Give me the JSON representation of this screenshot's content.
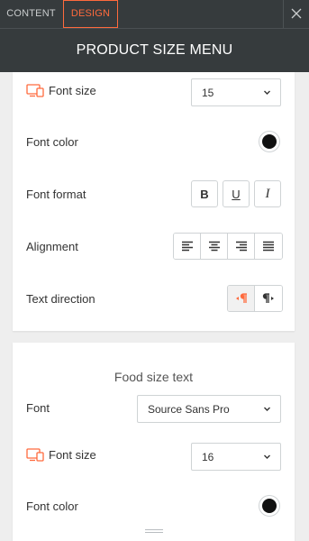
{
  "tabs": [
    {
      "label": "CONTENT",
      "active": false
    },
    {
      "label": "DESIGN",
      "active": true
    }
  ],
  "header": {
    "title": "PRODUCT SIZE MENU"
  },
  "accent_color": "#ff6a3d",
  "panel1": {
    "font_size": {
      "label": "Font size",
      "value": "15",
      "icon": "desktop-icon"
    },
    "font_color": {
      "label": "Font color",
      "color": "#111111"
    },
    "font_format": {
      "label": "Font format",
      "buttons": [
        "B",
        "U",
        "I"
      ]
    },
    "alignment": {
      "label": "Alignment",
      "options": [
        "align-left",
        "align-center",
        "align-right",
        "align-justify"
      ]
    },
    "text_direction": {
      "label": "Text direction",
      "options": [
        "ltr",
        "rtl"
      ],
      "active": "ltr"
    }
  },
  "panel2": {
    "section_title": "Food size text",
    "font": {
      "label": "Font",
      "value": "Source Sans Pro"
    },
    "font_size": {
      "label": "Font size",
      "value": "16",
      "icon": "desktop-icon"
    },
    "font_color": {
      "label": "Font color",
      "color": "#111111"
    }
  }
}
